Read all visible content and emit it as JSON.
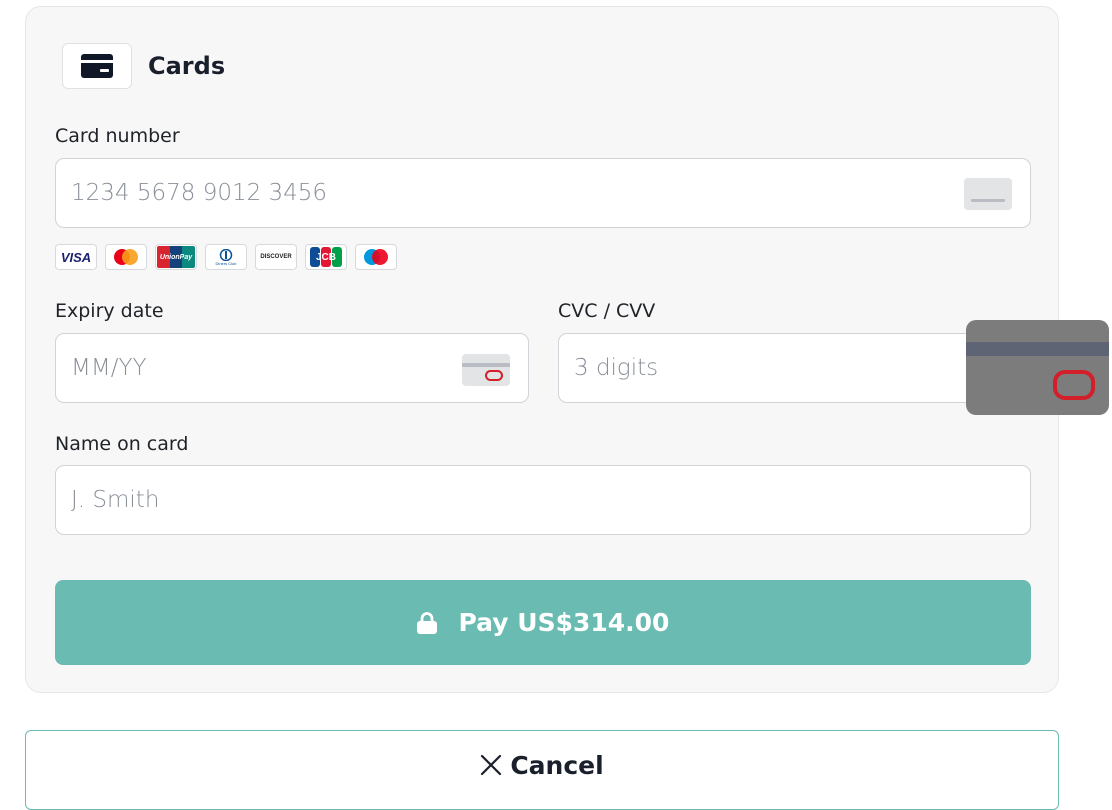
{
  "header": {
    "title": "Cards",
    "icon": "credit-card-icon"
  },
  "card_number": {
    "label": "Card number",
    "placeholder": "1234 5678 9012 3456",
    "icon": "card-generic-icon"
  },
  "brands": [
    {
      "name": "visa",
      "text": "VISA"
    },
    {
      "name": "mastercard",
      "text": ""
    },
    {
      "name": "unionpay",
      "text": "UnionPay"
    },
    {
      "name": "diners",
      "text": "Diners Club"
    },
    {
      "name": "discover",
      "text": "DISCOVER"
    },
    {
      "name": "jcb",
      "text": "JCB"
    },
    {
      "name": "maestro",
      "text": ""
    }
  ],
  "expiry": {
    "label": "Expiry date",
    "placeholder": "MM/YY",
    "icon": "card-back-icon"
  },
  "cvc": {
    "label": "CVC / CVV",
    "placeholder": "3 digits",
    "hint_icon": "cvc-location-icon"
  },
  "name_on_card": {
    "label": "Name on card",
    "placeholder": "J. Smith"
  },
  "pay_button": {
    "label": "Pay US$314.00",
    "icon": "lock-icon",
    "color": "#6abbb1"
  },
  "cancel_button": {
    "label": "Cancel",
    "icon": "close-icon"
  }
}
